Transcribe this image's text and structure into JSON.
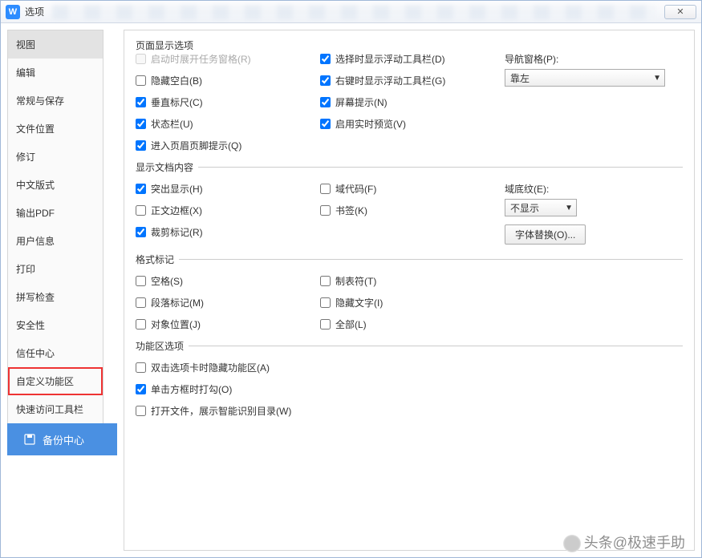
{
  "title": "选项",
  "close_glyph": "✕",
  "sidebar": {
    "items": [
      {
        "label": "视图",
        "selected": true
      },
      {
        "label": "编辑"
      },
      {
        "label": "常规与保存"
      },
      {
        "label": "文件位置"
      },
      {
        "label": "修订"
      },
      {
        "label": "中文版式"
      },
      {
        "label": "输出PDF"
      },
      {
        "label": "用户信息"
      },
      {
        "label": "打印"
      },
      {
        "label": "拼写检查"
      },
      {
        "label": "安全性"
      },
      {
        "label": "信任中心"
      },
      {
        "label": "自定义功能区",
        "highlighted": true
      },
      {
        "label": "快速访问工具栏"
      }
    ]
  },
  "groups": {
    "page_display": {
      "legend": "页面显示选项",
      "col1": [
        {
          "label": "启动时展开任务窗格(R)",
          "checked": false,
          "disabled": true
        },
        {
          "label": "隐藏空白(B)",
          "checked": false
        },
        {
          "label": "垂直标尺(C)",
          "checked": true
        },
        {
          "label": "状态栏(U)",
          "checked": true
        },
        {
          "label": "进入页眉页脚提示(Q)",
          "checked": true
        }
      ],
      "col2": [
        {
          "label": "选择时显示浮动工具栏(D)",
          "checked": true
        },
        {
          "label": "右键时显示浮动工具栏(G)",
          "checked": true
        },
        {
          "label": "屏幕提示(N)",
          "checked": true
        },
        {
          "label": "启用实时预览(V)",
          "checked": true
        }
      ],
      "nav_label": "导航窗格(P):",
      "nav_value": "靠左"
    },
    "doc_content": {
      "legend": "显示文档内容",
      "col1": [
        {
          "label": "突出显示(H)",
          "checked": true
        },
        {
          "label": "正文边框(X)",
          "checked": false
        },
        {
          "label": "裁剪标记(R)",
          "checked": true
        }
      ],
      "col2": [
        {
          "label": "域代码(F)",
          "checked": false
        },
        {
          "label": "书签(K)",
          "checked": false
        }
      ],
      "shade_label": "域底纹(E):",
      "shade_value": "不显示",
      "font_btn": "字体替换(O)..."
    },
    "format_marks": {
      "legend": "格式标记",
      "col1": [
        {
          "label": "空格(S)",
          "checked": false
        },
        {
          "label": "段落标记(M)",
          "checked": false
        },
        {
          "label": "对象位置(J)",
          "checked": false
        }
      ],
      "col2": [
        {
          "label": "制表符(T)",
          "checked": false
        },
        {
          "label": "隐藏文字(I)",
          "checked": false
        },
        {
          "label": "全部(L)",
          "checked": false
        }
      ]
    },
    "ribbon": {
      "legend": "功能区选项",
      "items": [
        {
          "label": "双击选项卡时隐藏功能区(A)",
          "checked": false
        },
        {
          "label": "单击方框时打勾(O)",
          "checked": true
        },
        {
          "label": "打开文件，展示智能识别目录(W)",
          "checked": false
        }
      ]
    }
  },
  "backup_btn": "备份中心",
  "watermark": "头条@极速手助"
}
